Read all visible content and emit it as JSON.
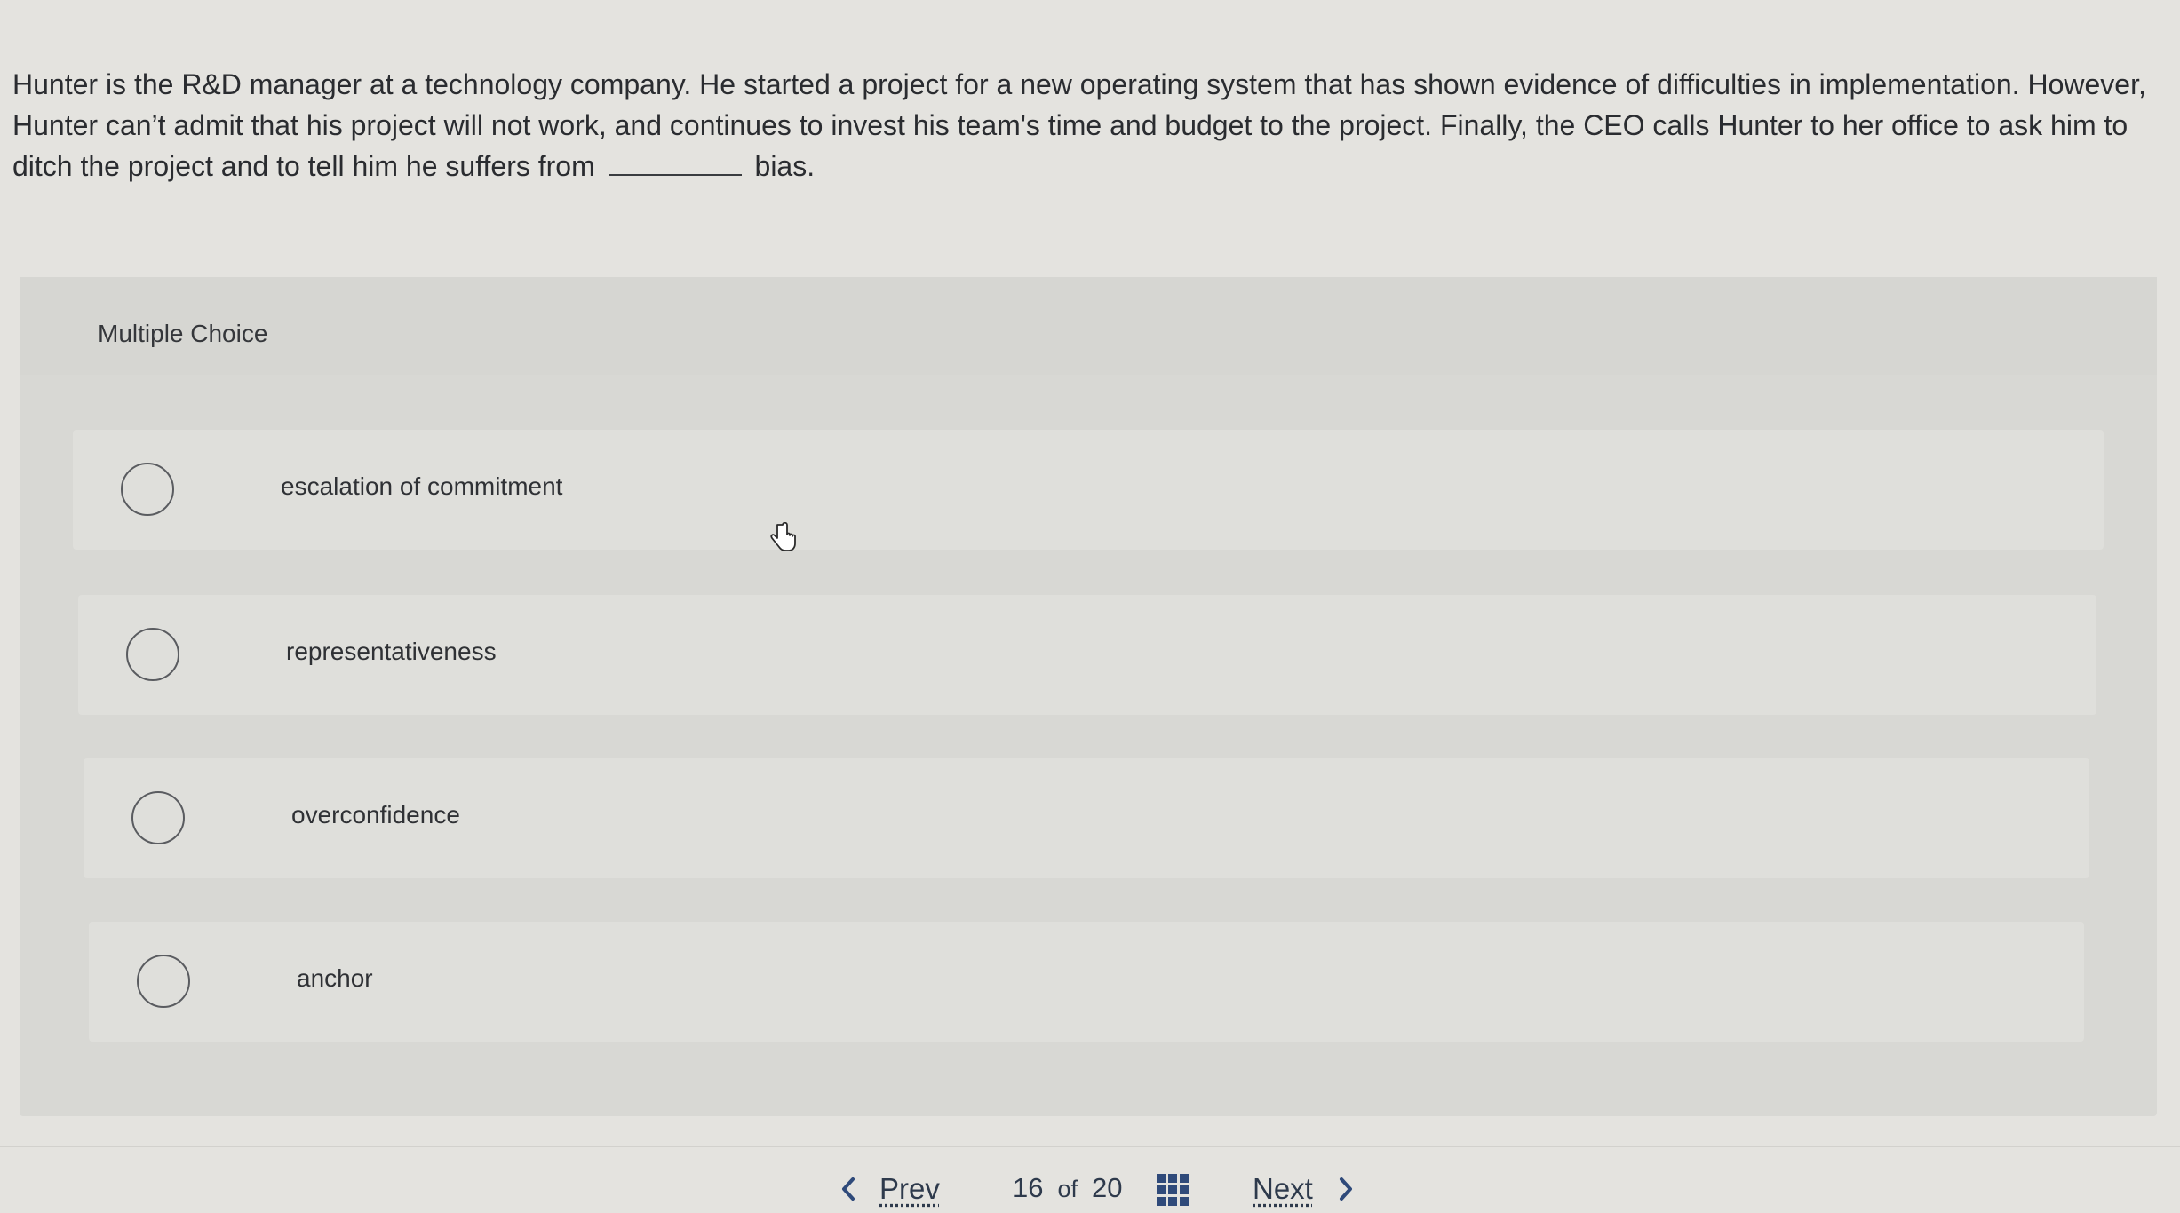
{
  "question": {
    "text_before_blank": "Hunter is the R&D manager at a technology company. He started a project for a new operating system that has shown evidence of difficulties in implementation. However, Hunter can’t admit that his project will not work, and continues to invest his team's time and budget to the project. Finally, the CEO calls Hunter to her office to ask him to ditch the project and to tell him he suffers from",
    "text_after_blank": "bias."
  },
  "multiple_choice": {
    "title": "Multiple Choice",
    "options": [
      {
        "label": "escalation of commitment",
        "selected": false
      },
      {
        "label": "representativeness",
        "selected": false
      },
      {
        "label": "overconfidence",
        "selected": false
      },
      {
        "label": "anchor",
        "selected": false
      }
    ]
  },
  "navigation": {
    "prev_label": "Prev",
    "current": "16",
    "of_label": "of",
    "total": "20",
    "next_label": "Next",
    "grid_icon": "question-grid-icon"
  },
  "colors": {
    "background": "#e4e3df",
    "nav_text": "#2e3a4c",
    "grid_icon": "#2f4a7a"
  }
}
